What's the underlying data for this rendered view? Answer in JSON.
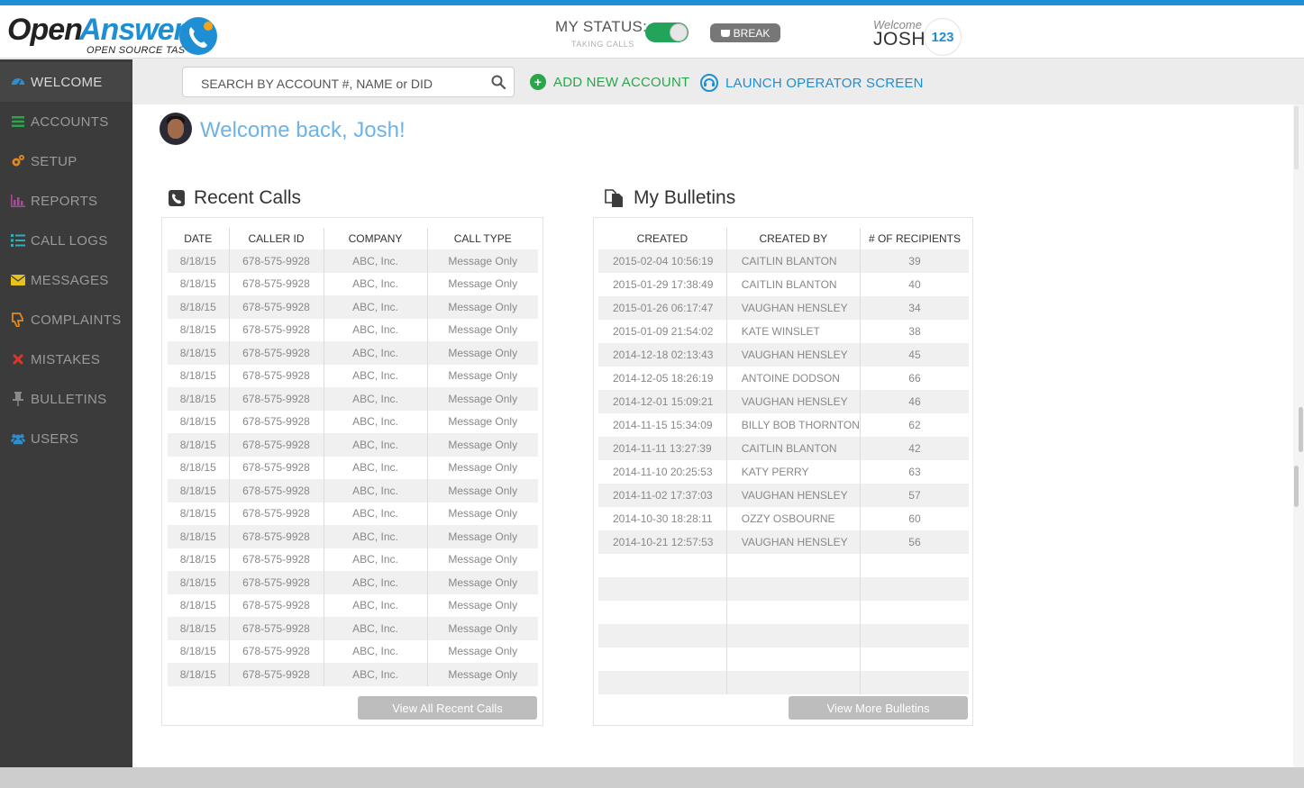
{
  "brand": {
    "name_part1": "Open",
    "name_part2": "Answer",
    "tagline": "OPEN SOURCE TAS",
    "accent": "#1e8fd4"
  },
  "status": {
    "label": "MY STATUS:",
    "sub": "TAKING CALLS",
    "toggle_on": true,
    "break_label": "BREAK"
  },
  "user": {
    "welcome": "Welcome",
    "name": "JOSH",
    "extension": "123"
  },
  "sidebar": {
    "items": [
      {
        "label": "WELCOME",
        "icon": "dashboard-icon",
        "color": "#2b8fd0"
      },
      {
        "label": "ACCOUNTS",
        "icon": "list-icon",
        "color": "#2aa64a"
      },
      {
        "label": "SETUP",
        "icon": "gears-icon",
        "color": "#e08a1e"
      },
      {
        "label": "REPORTS",
        "icon": "bar-chart-icon",
        "color": "#b0479c"
      },
      {
        "label": "CALL LOGS",
        "icon": "list-numbered-icon",
        "color": "#2bb0b8"
      },
      {
        "label": "MESSAGES",
        "icon": "envelope-icon",
        "color": "#e8c21a"
      },
      {
        "label": "COMPLAINTS",
        "icon": "thumbs-down-icon",
        "color": "#e08a1e"
      },
      {
        "label": "MISTAKES",
        "icon": "x-icon",
        "color": "#e0352b"
      },
      {
        "label": "BULLETINS",
        "icon": "pushpin-icon",
        "color": "#8a8a8a"
      },
      {
        "label": "USERS",
        "icon": "users-icon",
        "color": "#2b8fd0"
      }
    ]
  },
  "search": {
    "placeholder": "SEARCH BY ACCOUNT #, NAME or DID"
  },
  "actions": {
    "add_account": "ADD NEW ACCOUNT",
    "launch_operator": "LAUNCH OPERATOR SCREEN"
  },
  "welcome": {
    "title": "Welcome back, Josh!"
  },
  "recent_calls": {
    "title": "Recent Calls",
    "columns": [
      "DATE",
      "CALLER ID",
      "COMPANY",
      "CALL TYPE"
    ],
    "rows": [
      [
        "8/18/15",
        "678-575-9928",
        "ABC, Inc.",
        "Message Only"
      ],
      [
        "8/18/15",
        "678-575-9928",
        "ABC, Inc.",
        "Message Only"
      ],
      [
        "8/18/15",
        "678-575-9928",
        "ABC, Inc.",
        "Message Only"
      ],
      [
        "8/18/15",
        "678-575-9928",
        "ABC, Inc.",
        "Message Only"
      ],
      [
        "8/18/15",
        "678-575-9928",
        "ABC, Inc.",
        "Message Only"
      ],
      [
        "8/18/15",
        "678-575-9928",
        "ABC, Inc.",
        "Message Only"
      ],
      [
        "8/18/15",
        "678-575-9928",
        "ABC, Inc.",
        "Message Only"
      ],
      [
        "8/18/15",
        "678-575-9928",
        "ABC, Inc.",
        "Message Only"
      ],
      [
        "8/18/15",
        "678-575-9928",
        "ABC, Inc.",
        "Message Only"
      ],
      [
        "8/18/15",
        "678-575-9928",
        "ABC, Inc.",
        "Message Only"
      ],
      [
        "8/18/15",
        "678-575-9928",
        "ABC, Inc.",
        "Message Only"
      ],
      [
        "8/18/15",
        "678-575-9928",
        "ABC, Inc.",
        "Message Only"
      ],
      [
        "8/18/15",
        "678-575-9928",
        "ABC, Inc.",
        "Message Only"
      ],
      [
        "8/18/15",
        "678-575-9928",
        "ABC, Inc.",
        "Message Only"
      ],
      [
        "8/18/15",
        "678-575-9928",
        "ABC, Inc.",
        "Message Only"
      ],
      [
        "8/18/15",
        "678-575-9928",
        "ABC, Inc.",
        "Message Only"
      ],
      [
        "8/18/15",
        "678-575-9928",
        "ABC, Inc.",
        "Message Only"
      ],
      [
        "8/18/15",
        "678-575-9928",
        "ABC, Inc.",
        "Message Only"
      ],
      [
        "8/18/15",
        "678-575-9928",
        "ABC, Inc.",
        "Message Only"
      ]
    ],
    "button": "View All Recent Calls"
  },
  "bulletins": {
    "title": "My Bulletins",
    "columns": [
      "CREATED",
      "CREATED BY",
      "# OF RECIPIENTS"
    ],
    "rows": [
      [
        "2015-02-04 10:56:19",
        "CAITLIN BLANTON",
        "39"
      ],
      [
        "2015-01-29 17:38:49",
        "CAITLIN BLANTON",
        "40"
      ],
      [
        "2015-01-26 06:17:47",
        "VAUGHAN HENSLEY",
        "34"
      ],
      [
        "2015-01-09 21:54:02",
        "KATE WINSLET",
        "38"
      ],
      [
        "2014-12-18 02:13:43",
        "VAUGHAN HENSLEY",
        "45"
      ],
      [
        "2014-12-05 18:26:19",
        "ANTOINE DODSON",
        "66"
      ],
      [
        "2014-12-01 15:09:21",
        "VAUGHAN HENSLEY",
        "46"
      ],
      [
        "2014-11-15 15:34:09",
        "BILLY BOB THORNTON",
        "62"
      ],
      [
        "2014-11-11 13:27:39",
        "CAITLIN BLANTON",
        "42"
      ],
      [
        "2014-11-10 20:25:53",
        "KATY PERRY",
        "63"
      ],
      [
        "2014-11-02 17:37:03",
        "VAUGHAN HENSLEY",
        "57"
      ],
      [
        "2014-10-30 18:28:11",
        "OZZY OSBOURNE",
        "60"
      ],
      [
        "2014-10-21 12:57:53",
        "VAUGHAN HENSLEY",
        "56"
      ]
    ],
    "empty_rows": 6,
    "button": "View More Bulletins"
  }
}
